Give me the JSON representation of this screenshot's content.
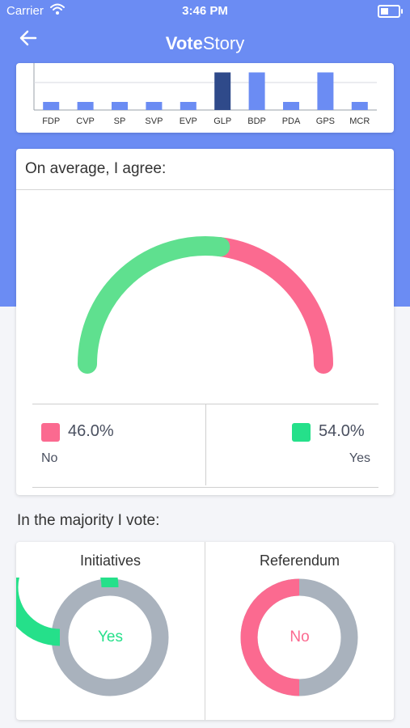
{
  "status_bar": {
    "carrier": "Carrier",
    "time": "3:46 PM"
  },
  "nav": {
    "title_bold": "Vote",
    "title_light": "Story"
  },
  "colors": {
    "header_bg": "#6b8cf3",
    "bar_light": "#6b8cf3",
    "bar_selected": "#2f4a8a",
    "no": "#fb6a90",
    "yes": "#25e08a",
    "gauge_yes": "#5fe08f",
    "neutral": "#a9b2bd"
  },
  "parties": {
    "selected": "GLP",
    "items": [
      {
        "label": "FDP",
        "value": 0.2
      },
      {
        "label": "CVP",
        "value": 0.2
      },
      {
        "label": "SP",
        "value": 0.2
      },
      {
        "label": "SVP",
        "value": 0.2
      },
      {
        "label": "EVP",
        "value": 0.2
      },
      {
        "label": "GLP",
        "value": 0.93
      },
      {
        "label": "BDP",
        "value": 0.93
      },
      {
        "label": "PDA",
        "value": 0.2
      },
      {
        "label": "GPS",
        "value": 0.93
      },
      {
        "label": "MCR",
        "value": 0.2
      }
    ]
  },
  "agree": {
    "title": "On average, I agree:",
    "no": {
      "percent": "46.0%",
      "label": "No",
      "value": 46.0
    },
    "yes": {
      "percent": "54.0%",
      "label": "Yes",
      "value": 54.0
    }
  },
  "majority": {
    "title": "In the majority I vote:",
    "initiatives": {
      "title": "Initiatives",
      "result": "Yes",
      "result_share": 0.75
    },
    "referendum": {
      "title": "Referendum",
      "result": "No",
      "result_share": 0.5
    }
  }
}
